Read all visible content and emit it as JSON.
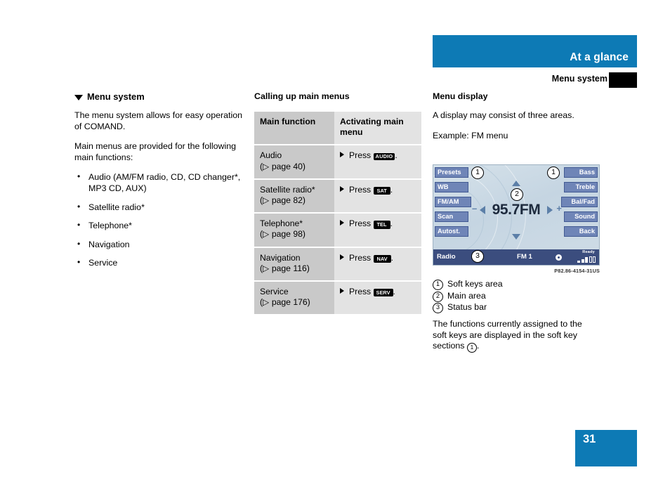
{
  "header": {
    "title": "At a glance",
    "subtitle": "Menu system"
  },
  "left_column": {
    "heading": "Menu system",
    "paragraph_1": "The menu system allows for easy operation of COMAND.",
    "paragraph_2": "Main menus are provided for the following main functions:",
    "bullets": [
      "Audio (AM/FM radio, CD, CD changer*, MP3 CD, AUX)",
      "Satellite radio*",
      "Telephone*",
      "Navigation",
      "Service"
    ]
  },
  "middle_column": {
    "heading": "Calling up main menus",
    "table": {
      "columns": [
        "Main function",
        "Activating main menu"
      ],
      "rows": [
        {
          "function": "Audio",
          "page_ref": "(▷ page 40)",
          "action_prefix": "Press",
          "key": "AUDIO",
          "action_suffix": "."
        },
        {
          "function": "Satellite radio*",
          "page_ref": "(▷ page 82)",
          "action_prefix": "Press",
          "key": "SAT",
          "action_suffix": "."
        },
        {
          "function": "Telephone*",
          "page_ref": "(▷ page 98)",
          "action_prefix": "Press",
          "key": "TEL",
          "action_suffix": "."
        },
        {
          "function": "Navigation",
          "page_ref": "(▷ page 116)",
          "action_prefix": "Press",
          "key": "NAV",
          "action_suffix": "."
        },
        {
          "function": "Service",
          "page_ref": "(▷ page 176)",
          "action_prefix": "Press",
          "key": "SERV",
          "action_suffix": "."
        }
      ]
    }
  },
  "right_column": {
    "heading": "Menu display",
    "paragraph_1": "A display may consist of three areas.",
    "paragraph_2": "Example: FM menu",
    "caption_code": "P82.86-4154-31US",
    "legend": [
      {
        "num": "1",
        "label": "Soft keys area"
      },
      {
        "num": "2",
        "label": "Main area"
      },
      {
        "num": "3",
        "label": "Status bar"
      }
    ],
    "closing_text_before": "The functions currently assigned to the soft keys are displayed in the soft key sections",
    "closing_marker": "1",
    "closing_text_after": "."
  },
  "comand_display": {
    "soft_keys_left": [
      "Presets",
      "WB",
      "FM/AM",
      "Scan",
      "Autost."
    ],
    "soft_keys_right": [
      "Bass",
      "Treble",
      "Bal/Fad",
      "Sound",
      "Back"
    ],
    "main_value": "95.7FM",
    "minus_sign": "–",
    "plus_sign": "+",
    "callouts": {
      "soft_keys_left_num": "1",
      "soft_keys_right_num": "1",
      "main_num": "2",
      "status_num": "3"
    },
    "status_bar": {
      "source": "Radio",
      "band": "FM 1",
      "ready_label": "Ready"
    }
  },
  "footer": {
    "page_number": "31"
  },
  "colors": {
    "brand_blue": "#0d7ab5",
    "softkey_blue": "#6f85b7",
    "statusbar_blue": "#3b4d7e",
    "table_col1": "#c9c9c9",
    "table_col2": "#e3e3e3"
  }
}
